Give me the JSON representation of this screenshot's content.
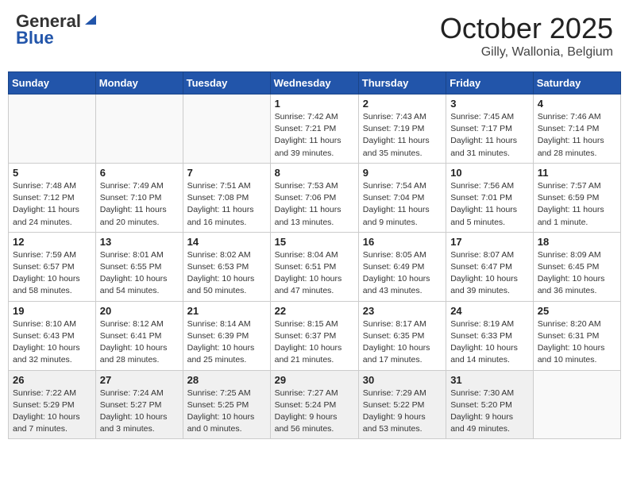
{
  "header": {
    "logo_general": "General",
    "logo_blue": "Blue",
    "month_title": "October 2025",
    "location": "Gilly, Wallonia, Belgium"
  },
  "columns": [
    "Sunday",
    "Monday",
    "Tuesday",
    "Wednesday",
    "Thursday",
    "Friday",
    "Saturday"
  ],
  "weeks": [
    [
      {
        "day": "",
        "info": ""
      },
      {
        "day": "",
        "info": ""
      },
      {
        "day": "",
        "info": ""
      },
      {
        "day": "1",
        "info": "Sunrise: 7:42 AM\nSunset: 7:21 PM\nDaylight: 11 hours\nand 39 minutes."
      },
      {
        "day": "2",
        "info": "Sunrise: 7:43 AM\nSunset: 7:19 PM\nDaylight: 11 hours\nand 35 minutes."
      },
      {
        "day": "3",
        "info": "Sunrise: 7:45 AM\nSunset: 7:17 PM\nDaylight: 11 hours\nand 31 minutes."
      },
      {
        "day": "4",
        "info": "Sunrise: 7:46 AM\nSunset: 7:14 PM\nDaylight: 11 hours\nand 28 minutes."
      }
    ],
    [
      {
        "day": "5",
        "info": "Sunrise: 7:48 AM\nSunset: 7:12 PM\nDaylight: 11 hours\nand 24 minutes."
      },
      {
        "day": "6",
        "info": "Sunrise: 7:49 AM\nSunset: 7:10 PM\nDaylight: 11 hours\nand 20 minutes."
      },
      {
        "day": "7",
        "info": "Sunrise: 7:51 AM\nSunset: 7:08 PM\nDaylight: 11 hours\nand 16 minutes."
      },
      {
        "day": "8",
        "info": "Sunrise: 7:53 AM\nSunset: 7:06 PM\nDaylight: 11 hours\nand 13 minutes."
      },
      {
        "day": "9",
        "info": "Sunrise: 7:54 AM\nSunset: 7:04 PM\nDaylight: 11 hours\nand 9 minutes."
      },
      {
        "day": "10",
        "info": "Sunrise: 7:56 AM\nSunset: 7:01 PM\nDaylight: 11 hours\nand 5 minutes."
      },
      {
        "day": "11",
        "info": "Sunrise: 7:57 AM\nSunset: 6:59 PM\nDaylight: 11 hours\nand 1 minute."
      }
    ],
    [
      {
        "day": "12",
        "info": "Sunrise: 7:59 AM\nSunset: 6:57 PM\nDaylight: 10 hours\nand 58 minutes."
      },
      {
        "day": "13",
        "info": "Sunrise: 8:01 AM\nSunset: 6:55 PM\nDaylight: 10 hours\nand 54 minutes."
      },
      {
        "day": "14",
        "info": "Sunrise: 8:02 AM\nSunset: 6:53 PM\nDaylight: 10 hours\nand 50 minutes."
      },
      {
        "day": "15",
        "info": "Sunrise: 8:04 AM\nSunset: 6:51 PM\nDaylight: 10 hours\nand 47 minutes."
      },
      {
        "day": "16",
        "info": "Sunrise: 8:05 AM\nSunset: 6:49 PM\nDaylight: 10 hours\nand 43 minutes."
      },
      {
        "day": "17",
        "info": "Sunrise: 8:07 AM\nSunset: 6:47 PM\nDaylight: 10 hours\nand 39 minutes."
      },
      {
        "day": "18",
        "info": "Sunrise: 8:09 AM\nSunset: 6:45 PM\nDaylight: 10 hours\nand 36 minutes."
      }
    ],
    [
      {
        "day": "19",
        "info": "Sunrise: 8:10 AM\nSunset: 6:43 PM\nDaylight: 10 hours\nand 32 minutes."
      },
      {
        "day": "20",
        "info": "Sunrise: 8:12 AM\nSunset: 6:41 PM\nDaylight: 10 hours\nand 28 minutes."
      },
      {
        "day": "21",
        "info": "Sunrise: 8:14 AM\nSunset: 6:39 PM\nDaylight: 10 hours\nand 25 minutes."
      },
      {
        "day": "22",
        "info": "Sunrise: 8:15 AM\nSunset: 6:37 PM\nDaylight: 10 hours\nand 21 minutes."
      },
      {
        "day": "23",
        "info": "Sunrise: 8:17 AM\nSunset: 6:35 PM\nDaylight: 10 hours\nand 17 minutes."
      },
      {
        "day": "24",
        "info": "Sunrise: 8:19 AM\nSunset: 6:33 PM\nDaylight: 10 hours\nand 14 minutes."
      },
      {
        "day": "25",
        "info": "Sunrise: 8:20 AM\nSunset: 6:31 PM\nDaylight: 10 hours\nand 10 minutes."
      }
    ],
    [
      {
        "day": "26",
        "info": "Sunrise: 7:22 AM\nSunset: 5:29 PM\nDaylight: 10 hours\nand 7 minutes."
      },
      {
        "day": "27",
        "info": "Sunrise: 7:24 AM\nSunset: 5:27 PM\nDaylight: 10 hours\nand 3 minutes."
      },
      {
        "day": "28",
        "info": "Sunrise: 7:25 AM\nSunset: 5:25 PM\nDaylight: 10 hours\nand 0 minutes."
      },
      {
        "day": "29",
        "info": "Sunrise: 7:27 AM\nSunset: 5:24 PM\nDaylight: 9 hours\nand 56 minutes."
      },
      {
        "day": "30",
        "info": "Sunrise: 7:29 AM\nSunset: 5:22 PM\nDaylight: 9 hours\nand 53 minutes."
      },
      {
        "day": "31",
        "info": "Sunrise: 7:30 AM\nSunset: 5:20 PM\nDaylight: 9 hours\nand 49 minutes."
      },
      {
        "day": "",
        "info": ""
      }
    ]
  ]
}
